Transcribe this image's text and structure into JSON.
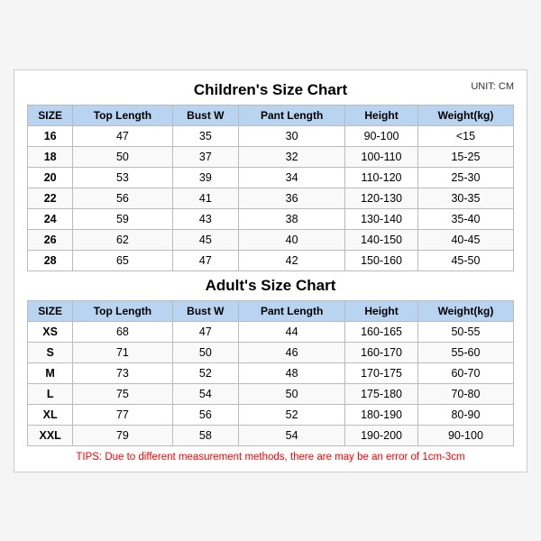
{
  "title": "Children's Size Chart",
  "unitLabel": "UNIT: CM",
  "children": {
    "headers": [
      "SIZE",
      "Top Length",
      "Bust W",
      "Pant Length",
      "Height",
      "Weight(kg)"
    ],
    "rows": [
      [
        "16",
        "47",
        "35",
        "30",
        "90-100",
        "<15"
      ],
      [
        "18",
        "50",
        "37",
        "32",
        "100-110",
        "15-25"
      ],
      [
        "20",
        "53",
        "39",
        "34",
        "110-120",
        "25-30"
      ],
      [
        "22",
        "56",
        "41",
        "36",
        "120-130",
        "30-35"
      ],
      [
        "24",
        "59",
        "43",
        "38",
        "130-140",
        "35-40"
      ],
      [
        "26",
        "62",
        "45",
        "40",
        "140-150",
        "40-45"
      ],
      [
        "28",
        "65",
        "47",
        "42",
        "150-160",
        "45-50"
      ]
    ]
  },
  "adultsTitle": "Adult's Size Chart",
  "adults": {
    "headers": [
      "SIZE",
      "Top Length",
      "Bust W",
      "Pant Length",
      "Height",
      "Weight(kg)"
    ],
    "rows": [
      [
        "XS",
        "68",
        "47",
        "44",
        "160-165",
        "50-55"
      ],
      [
        "S",
        "71",
        "50",
        "46",
        "160-170",
        "55-60"
      ],
      [
        "M",
        "73",
        "52",
        "48",
        "170-175",
        "60-70"
      ],
      [
        "L",
        "75",
        "54",
        "50",
        "175-180",
        "70-80"
      ],
      [
        "XL",
        "77",
        "56",
        "52",
        "180-190",
        "80-90"
      ],
      [
        "XXL",
        "79",
        "58",
        "54",
        "190-200",
        "90-100"
      ]
    ]
  },
  "tips": "TIPS: Due to different measurement methods, there are may be an error of 1cm-3cm"
}
